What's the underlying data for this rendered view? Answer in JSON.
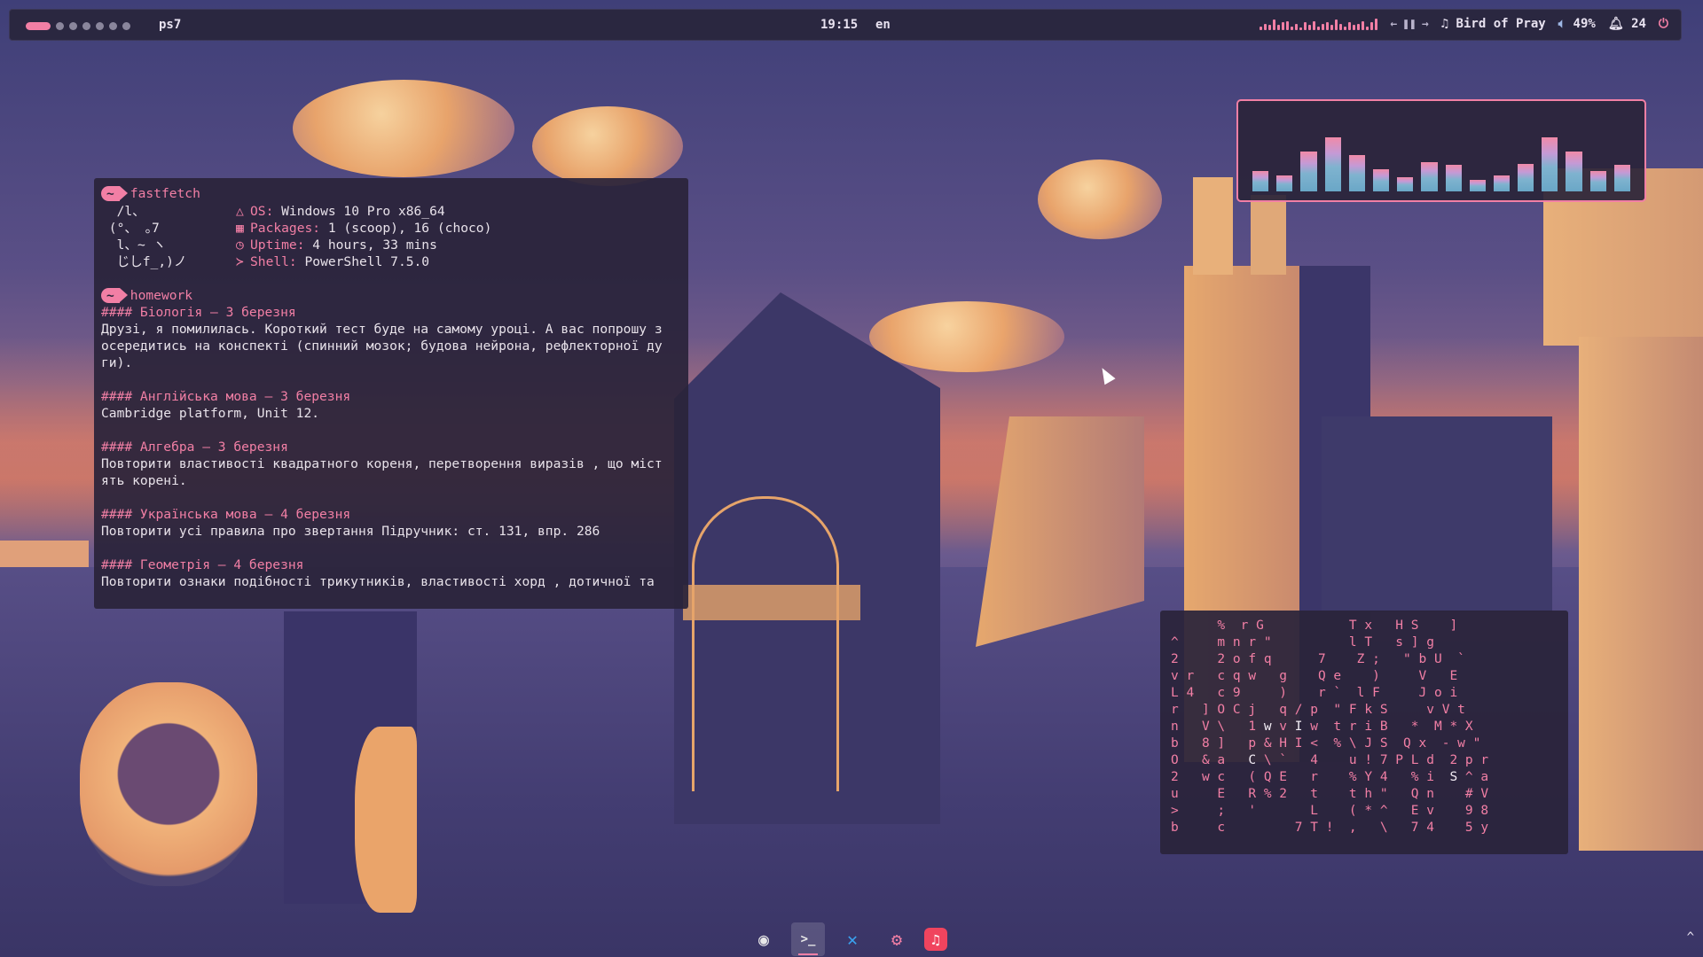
{
  "topbar": {
    "workspaces": [
      true,
      false,
      false,
      false,
      false,
      false,
      false
    ],
    "window_title": "ps7",
    "clock": "19:15",
    "lang": "en",
    "mini_visualizer": [
      3,
      5,
      4,
      8,
      4,
      6,
      7,
      3,
      5,
      2,
      6,
      4,
      7,
      3,
      5,
      6,
      4,
      8,
      5,
      3,
      6,
      4,
      5,
      7,
      3,
      6,
      9
    ],
    "media_controls": [
      "←",
      "❚❚",
      "→"
    ],
    "track": "Bird of Pray",
    "volume": "49%",
    "notifications": "24",
    "icons": {
      "music": "music-note-icon",
      "volume": "speaker-icon",
      "bell": "bell-icon",
      "power": "power-icon"
    }
  },
  "terminal": {
    "prompt_symbol": "~",
    "cmd1": "fastfetch",
    "ascii_art": "  /l、\n (°、 ｡7\n  l、~ ヽ\n  じしf_,)ノ",
    "fetch": [
      {
        "icon": "△",
        "key": "OS:",
        "value": " Windows 10 Pro x86_64"
      },
      {
        "icon": "▦",
        "key": "Packages:",
        "value": " 1 (scoop), 16 (choco)"
      },
      {
        "icon": "◷",
        "key": "Uptime:",
        "value": " 4 hours, 33 mins"
      },
      {
        "icon": "≻",
        "key": "Shell:",
        "value": " PowerShell 7.5.0"
      }
    ],
    "cmd2": "homework",
    "homework": [
      {
        "heading": "#### Біологія – 3 березня",
        "text": "Друзі, я помилилась. Короткий тест буде на самому уроці. А вас попрошу з\nосередитись на конспекті (спинний мозок; будова нейрона, рефлекторної ду\nги)."
      },
      {
        "heading": "#### Англійська мова – 3 березня",
        "text": "Cambridge platform, Unit 12."
      },
      {
        "heading": "#### Алгебра – 3 березня",
        "text": "Повторити властивості квадратного кореня, перетворення виразів , що міст\nять корені."
      },
      {
        "heading": "#### Українська мова – 4 березня",
        "text": "Повторити усі правила про звертання Підручник: ст. 131, впр. 286"
      },
      {
        "heading": "#### Геометрія – 4 березня",
        "text": "Повторити ознаки подібності трикутників, властивості хорд , дотичної та"
      }
    ]
  },
  "visualizer": {
    "levels": [
      0.28,
      0.22,
      0.55,
      0.75,
      0.5,
      0.3,
      0.2,
      0.4,
      0.36,
      0.16,
      0.22,
      0.38,
      0.75,
      0.55,
      0.28,
      0.36
    ]
  },
  "matrix": {
    "lines": [
      "      %  r G           T x   H S    ]",
      "^     m n r \"          l T   s ] g",
      "2     2 o f q      7    Z ;   \" b U  `",
      "v r   c q w   g    Q e    )     V   E",
      "L 4   c 9     )    r `  l F     J o i",
      "r   ] O C j   q / p  \" F k S     v V t",
      "n   V \\   1 w v I w  t r i B   *  M * X",
      "b   8 ]   p & H I <  % \\ J S  Q x  - w \"",
      "O   & a   C \\ `   4    u ! 7 P L d  2 p r",
      "2   w c   ( Q E   r    % Y 4   % i  S ^ a",
      "u     E   R % 2   t    t h \"   Q n    # V",
      ">     ;   '       L    ( * ^   E v    9 8",
      "b     c         7 T !  ,   \\   7 4    5 y"
    ],
    "white_chars": [
      "C",
      "I",
      "P",
      "S",
      "b",
      "V",
      "c",
      "w"
    ]
  },
  "dock": {
    "items": [
      {
        "name": "obs-icon",
        "glyph": "◉",
        "color": "#e8e8e8"
      },
      {
        "name": "terminal-icon",
        "glyph": ">_",
        "color": "#e8e8e8",
        "active": true
      },
      {
        "name": "vscode-icon",
        "glyph": "✕",
        "color": "#3aa3f0"
      },
      {
        "name": "app-badge-icon",
        "glyph": "⚙",
        "color": "#f27fa5"
      },
      {
        "name": "music-app-icon",
        "glyph": "♫",
        "color": "#ffffff"
      }
    ]
  },
  "tray_arrow": "^"
}
